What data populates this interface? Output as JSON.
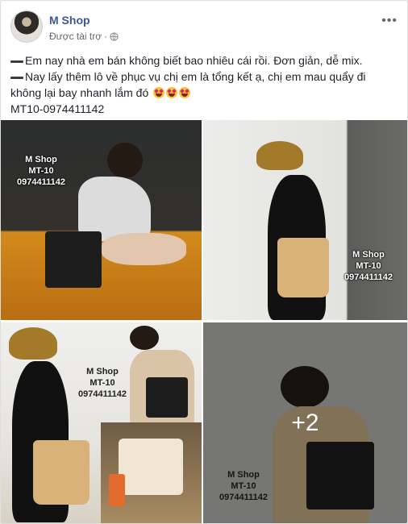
{
  "post": {
    "page_name": "M Shop",
    "sponsored_label": "Được tài trợ",
    "sponsored_separator": "·",
    "more_label": "•••",
    "lines": [
      "Em nay nhà em bán không biết bao nhiêu cái rồi. Đơn giản, dễ mix.",
      "Nay lấy thêm lô về phục vụ chị em là tổng kết ạ, chị em mau quẩy đi không lại bay nhanh lắm đó",
      "MT10-0974411142"
    ],
    "emoji_count": 3
  },
  "photos": [
    {
      "watermark": [
        "M Shop",
        "MT-10",
        "0974411142"
      ]
    },
    {
      "watermark": [
        "M Shop",
        "MT-10",
        "0974411142"
      ]
    },
    {
      "watermark": [
        "M Shop",
        "MT-10",
        "0974411142"
      ]
    },
    {
      "watermark": [
        "M Shop",
        "MT-10",
        "0974411142"
      ],
      "more_count": "+2"
    }
  ],
  "colors": {
    "link": "#385898",
    "text": "#1d2129",
    "meta": "#616770",
    "border": "#dddfe2"
  }
}
